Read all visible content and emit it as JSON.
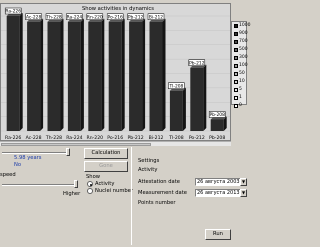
{
  "window": {
    "title": "Show activities in dynamics"
  },
  "chart_data": {
    "type": "bar",
    "title": "Show activities in dynamics",
    "categories": [
      "Ra-226",
      "Ac-228",
      "Th-228",
      "Ra-224",
      "Rn-220",
      "Po-216",
      "Pb-212",
      "Bi-212",
      "Tl-208",
      "Po-212",
      "Pb-208"
    ],
    "visible_tick_labels": [
      "Ra-226",
      "Ac-228",
      "Th-228",
      "Ra-224",
      "Rn-220",
      "Po-216",
      "Pb-212",
      "Bi-212",
      "Tl-208",
      "Po-212",
      "Pb-208"
    ],
    "bar_labels": [
      "Ra-226",
      "Ac-228",
      "Th-228",
      "Ra-224",
      "Rn-220",
      "Po-216",
      "Pb-212",
      "Bi-212",
      "Tl-208",
      "Pb-212",
      "Pb-208"
    ],
    "values": [
      1000,
      950,
      950,
      950,
      950,
      950,
      950,
      950,
      350,
      550,
      100
    ],
    "ylim": [
      0,
      1000
    ],
    "legend_position": "right",
    "legend_entries": [
      "1000",
      "900",
      "700",
      "500",
      "300",
      "100",
      "50",
      "10",
      "5",
      "1",
      "0"
    ]
  },
  "colors": {
    "bar_fill": "#2b2b2b",
    "chart_bg": "#d8d8d8",
    "window_bg": "#d4d0c8",
    "value_blue": "#1a3aa8"
  },
  "controls": {
    "calculation_button": "Calculation",
    "gone_button": "Gone",
    "half_life_value": "5.98 years",
    "no_label": "No",
    "speed_label": "speed",
    "higher_label": "Higher",
    "show_title": "Show",
    "radio_activity": "Activity",
    "radio_nuclei": "Nuclei number",
    "settings_title": "Settings",
    "activity_label": "Activity",
    "attestation_label": "Attestation date",
    "measurement_label": "Measurement date",
    "points_label": "Points number",
    "attestation_date": "26  августа  2003 г.",
    "measurement_date": "26  августа  2013 г.",
    "run_button": "Run"
  }
}
